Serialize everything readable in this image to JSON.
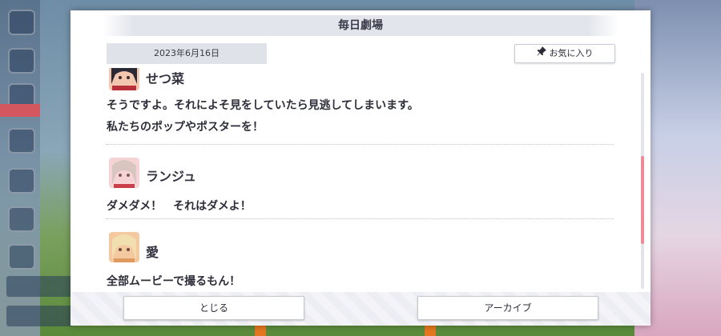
{
  "dialog": {
    "title": "毎日劇場",
    "date": "2023年6月16日",
    "favorite_label": "お気に入り"
  },
  "entries": [
    {
      "name": "せつ菜",
      "avatar": "setsuna-avatar",
      "lines": [
        "そうですよ。それによそ見をしていたら見逃してしまいます。",
        "私たちのポップやポスターを！"
      ]
    },
    {
      "name": "ランジュ",
      "avatar": "lanzhu-avatar",
      "lines": [
        "ダメダメ！　それはダメよ！"
      ]
    },
    {
      "name": "愛",
      "avatar": "ai-avatar",
      "lines": [
        "全部ムービーで撮るもん！"
      ]
    }
  ],
  "buttons": {
    "close": "とじる",
    "archive": "アーカイブ"
  },
  "colors": {
    "scroll_thumb": "#f08a96",
    "accent_red": "#d4565e"
  }
}
